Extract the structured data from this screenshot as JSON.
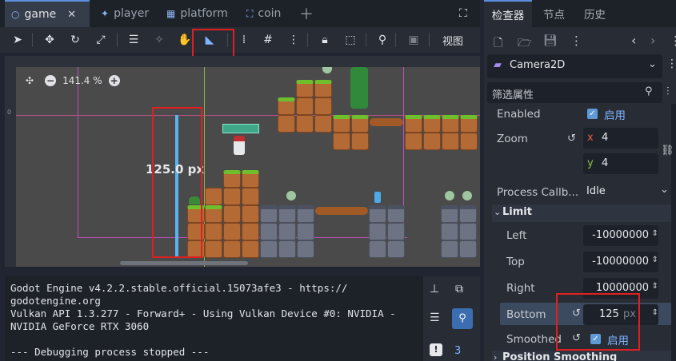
{
  "tabs": [
    {
      "label": "game",
      "icon": "circle-node-icon",
      "active": true
    },
    {
      "label": "player",
      "icon": "character-node-icon"
    },
    {
      "label": "platform",
      "icon": "tilemap-node-icon"
    },
    {
      "label": "coin",
      "icon": "frame-node-icon"
    }
  ],
  "toolbar": {
    "view_label": "视图"
  },
  "viewport": {
    "zoom": "141.4 %",
    "measure_label": "125.0 px",
    "ruler_v_marker": "0"
  },
  "console": {
    "text": "Godot Engine v4.2.2.stable.official.15073afe3 - https://\ngodotengine.org\nVulkan API 1.3.277 - Forward+ - Using Vulkan Device #0: NVIDIA -\nNVIDIA GeForce RTX 3060\n\n--- Debugging process stopped ---",
    "error_count": "3"
  },
  "inspector": {
    "tabs": [
      "检查器",
      "节点",
      "历史"
    ],
    "node_name": "Camera2D",
    "filter_placeholder": "筛选属性",
    "enabled_label": "Enabled",
    "enabled_value": "启用",
    "zoom_label": "Zoom",
    "zoom_x_axis": "x",
    "zoom_x": "4",
    "zoom_y_axis": "y",
    "zoom_y": "4",
    "process_label": "Process Callb...",
    "process_value": "Idle",
    "limit_section": "Limit",
    "left_label": "Left",
    "left_value": "-10000000",
    "top_label": "Top",
    "top_value": "-10000000",
    "right_label": "Right",
    "right_value": "10000000",
    "bottom_label": "Bottom",
    "bottom_value": "125",
    "bottom_unit": "px",
    "smoothed_label": "Smoothed",
    "smoothed_value": "启用",
    "next_section": "Position Smoothing"
  },
  "colors": {
    "accent": "#5d8fe0",
    "highlight_red": "#e02020",
    "measure_line": "#5ab4f0"
  }
}
